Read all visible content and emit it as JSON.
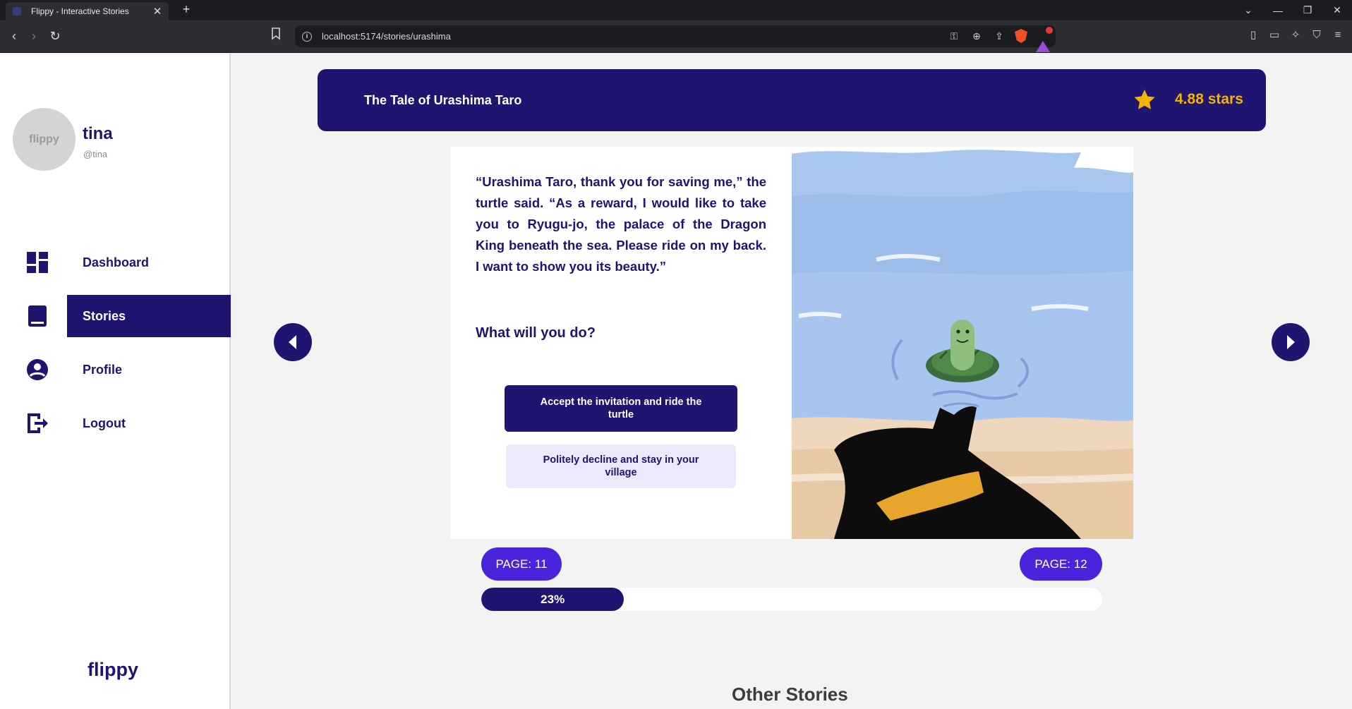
{
  "browser": {
    "tab_title": "Flippy - Interactive Stories",
    "tab_close": "✕",
    "new_tab": "+",
    "url": "localhost:5174/stories/urashima",
    "window_controls": [
      "⌄",
      "—",
      "❐",
      "✕"
    ],
    "nav": {
      "back": "‹",
      "forward": "›",
      "reload": "↻"
    }
  },
  "sidebar": {
    "avatar_text": "flippy",
    "user_name": "tina",
    "user_handle": "@tina",
    "items": [
      {
        "label": "Dashboard",
        "icon": "dashboard-icon",
        "active": false
      },
      {
        "label": "Stories",
        "icon": "book-icon",
        "active": true
      },
      {
        "label": "Profile",
        "icon": "account-circle-icon",
        "active": false
      },
      {
        "label": "Logout",
        "icon": "logout-icon",
        "active": false
      }
    ],
    "brand": "flippy"
  },
  "story": {
    "title": "The Tale of Urashima Taro",
    "rating": "4.88 stars",
    "text": "“Urashima Taro, thank you for saving me,” the turtle said. “As a reward, I would like to take you to Ryugu-jo, the palace of the Dragon King beneath the sea. Please ride on my back. I want to show you its beauty.”",
    "question": "What will you do?",
    "choices": [
      "Accept the invitation and ride the turtle",
      "Politely decline and stay in your village"
    ],
    "page_left": "PAGE: 11",
    "page_right": "PAGE: 12",
    "progress_label": "23%",
    "progress_value": 0.23
  },
  "other_stories_heading": "Other Stories",
  "colors": {
    "primary": "#1f1470",
    "accent": "#4a23dc",
    "star": "#f5b301",
    "background": "#f3f3f3"
  }
}
